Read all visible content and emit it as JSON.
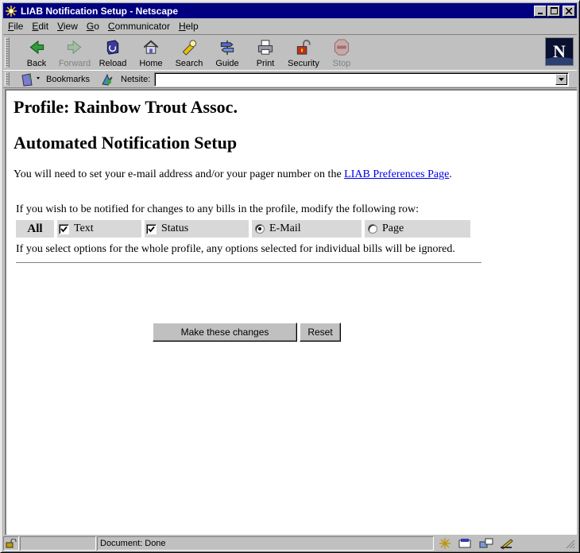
{
  "window": {
    "title": "LIAB Notification Setup - Netscape"
  },
  "menu": {
    "items": [
      {
        "label": "File",
        "accel": "F",
        "rest": "ile"
      },
      {
        "label": "Edit",
        "accel": "E",
        "rest": "dit"
      },
      {
        "label": "View",
        "accel": "V",
        "rest": "iew"
      },
      {
        "label": "Go",
        "accel": "G",
        "rest": "o"
      },
      {
        "label": "Communicator",
        "accel": "C",
        "rest": "ommunicator"
      },
      {
        "label": "Help",
        "accel": "H",
        "rest": "elp"
      }
    ]
  },
  "toolbar": {
    "back": "Back",
    "forward": "Forward",
    "reload": "Reload",
    "home": "Home",
    "search": "Search",
    "guide": "Guide",
    "print": "Print",
    "security": "Security",
    "stop": "Stop"
  },
  "location": {
    "bookmarks_label": "Bookmarks",
    "netsite_label": "Netsite:",
    "url": ""
  },
  "page": {
    "profile_heading": "Profile: Rainbow Trout Assoc.",
    "setup_heading": "Automated Notification Setup",
    "intro_text": "You will need to set your e-mail address and/or your pager number on the ",
    "prefs_link": "LIAB Preferences Page",
    "intro_end": ".",
    "row_instruction": "If you wish to be notified for changes to any bills in the profile, modify the following row:",
    "options": {
      "all_label": "All",
      "text_label": "Text",
      "text_checked": true,
      "status_label": "Status",
      "status_checked": true,
      "email_label": "E-Mail",
      "email_selected": true,
      "page_label": "Page",
      "page_selected": false
    },
    "note": "If you select options for the whole profile, any options selected for individual bills will be ignored.",
    "submit_button": "Make these changes",
    "reset_button": "Reset"
  },
  "status": {
    "text": "Document: Done"
  },
  "colors": {
    "titlebar": "#000080",
    "link": "#0000ee",
    "option_cell": "#d8d8d8",
    "chrome": "#c0c0c0"
  }
}
